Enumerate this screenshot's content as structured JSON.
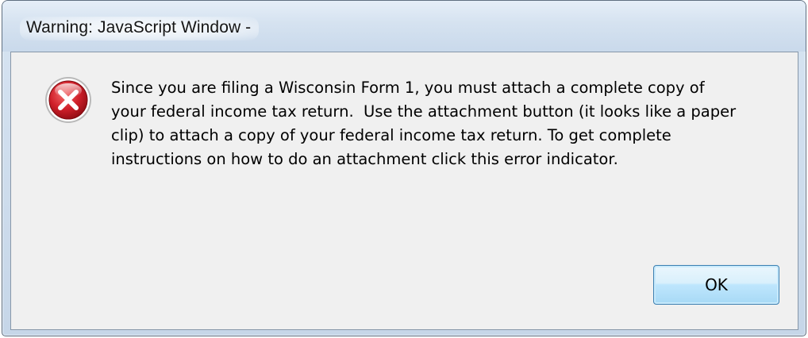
{
  "window": {
    "title": "Warning: JavaScript Window -"
  },
  "dialog": {
    "icon": "error-icon",
    "message": "Since you are filing a Wisconsin Form 1, you must attach a complete copy of\nyour federal income tax return.  Use the attachment button (it looks like a paper\nclip) to attach a copy of your federal income tax return. To get complete\ninstructions on how to do an attachment click this error indicator.",
    "ok_label": "OK"
  },
  "colors": {
    "error_red": "#d0202a",
    "button_border": "#3c7fb1",
    "client_background": "#f0f0f0"
  }
}
